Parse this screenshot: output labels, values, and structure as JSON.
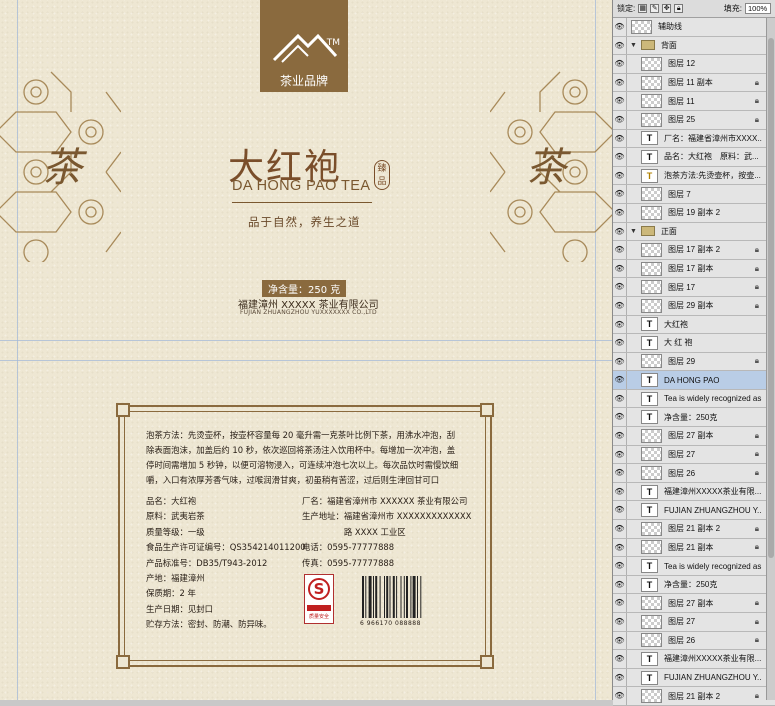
{
  "design": {
    "brand_label": "茶业品牌",
    "tm": "TM",
    "cha_char": "茶",
    "title_cn": "大红袍",
    "seal": "臻品",
    "title_en": "DA HONG PAO TEA",
    "slogan": "品于自然，养生之道",
    "net_content": "净含量：250 克",
    "company_cn": "福建漳州 XXXXX 茶业有限公司",
    "company_en": "FUJIAN ZHUANGZHOU YUXXXXXXX CO.,LTD",
    "method": "泡茶方法：先烫壶杯，按壶杯容量每 20 毫升需一克茶叶比例下茶，用沸水冲泡，刮除表面泡沫，加盖后约 10 秒，依次巡回将茶汤注入饮用杯中。每增加一次冲泡，盖停时间需增加 5 秒钟，以便可溶物浸入，可连续冲泡七次以上。每次品饮时需慢饮细嚼，入口有浓厚芳香气味，过喉润滑甘爽，初虽稍有苦涩，过后则生津回甘可口",
    "info_left": [
      "品名：大红袍",
      "原料：武夷岩茶",
      "质量等级：一级",
      "食品生产许可证编号：QS354214011200",
      "产品标准号：DB35/T943-2012",
      "产地：福建漳州",
      "保质期：2 年",
      "生产日期：见封口",
      "贮存方法：密封、防潮、防异味。"
    ],
    "info_right": [
      "厂名：福建省漳州市 XXXXXX 茶业有限公司",
      "生产地址：福建省漳州市 XXXXXXXXXXXXX",
      "　　　　　路 XXXX 工业区",
      "电话：0595-77777888",
      "传真：0595-77777888"
    ],
    "qs_text": "QS",
    "qs_caption": "质量安全",
    "barcode_num": "6 966170 088888"
  },
  "panel": {
    "lock_label": "锁定:",
    "fill_label": "填充:",
    "fill_value": "100%",
    "layers": [
      {
        "kind": "img",
        "name": "辅助线",
        "lock": false,
        "indent": false
      },
      {
        "kind": "folder",
        "name": "背面",
        "lock": false,
        "indent": false
      },
      {
        "kind": "img",
        "name": "图层 12",
        "lock": false,
        "indent": true
      },
      {
        "kind": "img",
        "name": "图层 11 副本",
        "lock": true,
        "indent": true
      },
      {
        "kind": "img",
        "name": "图层 11",
        "lock": true,
        "indent": true
      },
      {
        "kind": "img",
        "name": "图层 25",
        "lock": true,
        "indent": true
      },
      {
        "kind": "text",
        "name": "厂名：福建省漳州市XXXX...",
        "lock": false,
        "indent": true
      },
      {
        "kind": "text",
        "name": "品名：大红袍　原料：武...",
        "lock": false,
        "indent": true
      },
      {
        "kind": "textwarn",
        "name": "泡茶方法:先烫壶杯，按壶...",
        "lock": false,
        "indent": true
      },
      {
        "kind": "img",
        "name": "图层 7",
        "lock": false,
        "indent": true
      },
      {
        "kind": "img",
        "name": "图层 19 副本 2",
        "lock": false,
        "indent": true
      },
      {
        "kind": "folder",
        "name": "正面",
        "lock": false,
        "indent": false
      },
      {
        "kind": "img",
        "name": "图层 17 副本 2",
        "lock": true,
        "indent": true
      },
      {
        "kind": "img",
        "name": "图层 17 副本",
        "lock": true,
        "indent": true
      },
      {
        "kind": "img",
        "name": "图层 17",
        "lock": true,
        "indent": true
      },
      {
        "kind": "img",
        "name": "图层 29 副本",
        "lock": true,
        "indent": true
      },
      {
        "kind": "text",
        "name": "大红袍",
        "lock": false,
        "indent": true
      },
      {
        "kind": "text",
        "name": "大 红 袍",
        "lock": false,
        "indent": true
      },
      {
        "kind": "img",
        "name": "图层 29",
        "lock": true,
        "indent": true
      },
      {
        "kind": "text",
        "name": "DA HONG PAO",
        "lock": false,
        "indent": true,
        "selected": true
      },
      {
        "kind": "text",
        "name": "Tea is widely recognized as...",
        "lock": false,
        "indent": true
      },
      {
        "kind": "text",
        "name": "净含量：250克",
        "lock": false,
        "indent": true
      },
      {
        "kind": "img",
        "name": "图层 27 副本",
        "lock": true,
        "indent": true
      },
      {
        "kind": "img",
        "name": "图层 27",
        "lock": true,
        "indent": true
      },
      {
        "kind": "img",
        "name": "图层 26",
        "lock": true,
        "indent": true
      },
      {
        "kind": "text",
        "name": "福建漳州XXXXX茶业有限...",
        "lock": false,
        "indent": true
      },
      {
        "kind": "text",
        "name": "FUJIAN ZHUANGZHOU Y...",
        "lock": false,
        "indent": true
      },
      {
        "kind": "img",
        "name": "图层 21 副本 2",
        "lock": true,
        "indent": true
      },
      {
        "kind": "img",
        "name": "图层 21 副本",
        "lock": true,
        "indent": true
      },
      {
        "kind": "text",
        "name": "Tea is widely recognized as...",
        "lock": false,
        "indent": true
      },
      {
        "kind": "text",
        "name": "净含量：250克",
        "lock": false,
        "indent": true
      },
      {
        "kind": "img",
        "name": "图层 27 副本",
        "lock": true,
        "indent": true
      },
      {
        "kind": "img",
        "name": "图层 27",
        "lock": true,
        "indent": true
      },
      {
        "kind": "img",
        "name": "图层 26",
        "lock": true,
        "indent": true
      },
      {
        "kind": "text",
        "name": "福建漳州XXXXX茶业有限...",
        "lock": false,
        "indent": true
      },
      {
        "kind": "text",
        "name": "FUJIAN ZHUANGZHOU Y...",
        "lock": false,
        "indent": true
      },
      {
        "kind": "img",
        "name": "图层 21 副本 2",
        "lock": true,
        "indent": true
      }
    ]
  }
}
